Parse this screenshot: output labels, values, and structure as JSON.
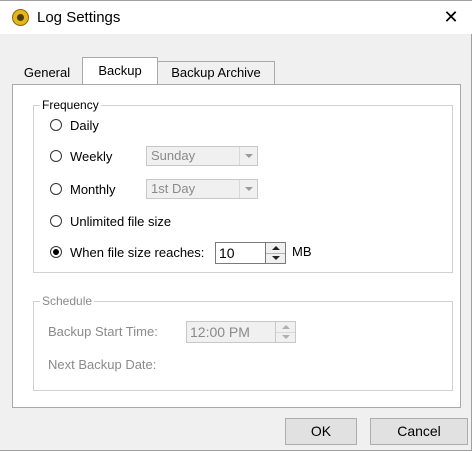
{
  "window": {
    "title": "Log Settings",
    "close_glyph": "✕",
    "app_icon": "settings-gear-icon"
  },
  "tabs": [
    {
      "label": "General",
      "selected": false
    },
    {
      "label": "Backup",
      "selected": true
    },
    {
      "label": "Backup Archive",
      "selected": false
    }
  ],
  "frequency": {
    "title": "Frequency",
    "options": [
      {
        "label": "Daily",
        "checked": false
      },
      {
        "label": "Weekly",
        "checked": false
      },
      {
        "label": "Monthly",
        "checked": false
      },
      {
        "label": "Unlimited file size",
        "checked": false
      },
      {
        "label": "When file size reaches:",
        "checked": true
      }
    ],
    "weekly_day": "Sunday",
    "monthly_day": "1st Day",
    "size_value": "10",
    "size_unit": "MB"
  },
  "schedule": {
    "title": "Schedule",
    "start_time_label": "Backup Start Time:",
    "start_time_value": "12:00 PM",
    "next_date_label": "Next Backup Date:"
  },
  "buttons": {
    "ok": "OK",
    "cancel": "Cancel"
  }
}
